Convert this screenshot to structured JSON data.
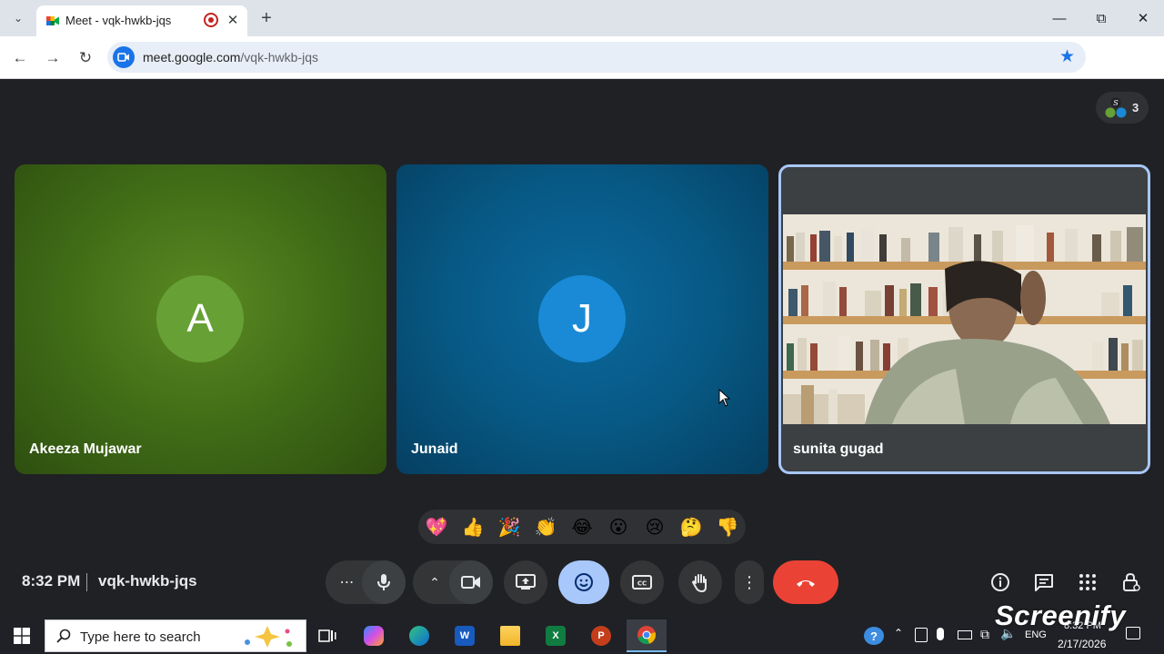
{
  "browser": {
    "tab_title": "Meet - vqk-hwkb-jqs",
    "url_host": "meet.google.com",
    "url_path": "/vqk-hwkb-jqs",
    "profile_initial": "S"
  },
  "meet": {
    "participant_count": "3",
    "participants": [
      {
        "name": "Akeeza Mujawar",
        "initial": "A",
        "avatar_color": "#67a136"
      },
      {
        "name": "Junaid",
        "initial": "J",
        "avatar_color": "#1a8ad6"
      },
      {
        "name": "sunita gugad",
        "has_video": true
      }
    ],
    "reactions": [
      "💖",
      "👍",
      "🎉",
      "👏",
      "😂",
      "😮",
      "😢",
      "🤔",
      "👎"
    ],
    "clock": "8:32 PM",
    "meeting_code": "vqk-hwkb-jqs",
    "colors": {
      "leave": "#ea4335",
      "active_control": "#a8c7fa",
      "speaker_border": "#a8c7fa"
    }
  },
  "taskbar": {
    "search_placeholder": "Type here to search",
    "lang": "ENG",
    "time": "8:32 PM",
    "date": "2/17/2026"
  },
  "watermark": "Screenify"
}
